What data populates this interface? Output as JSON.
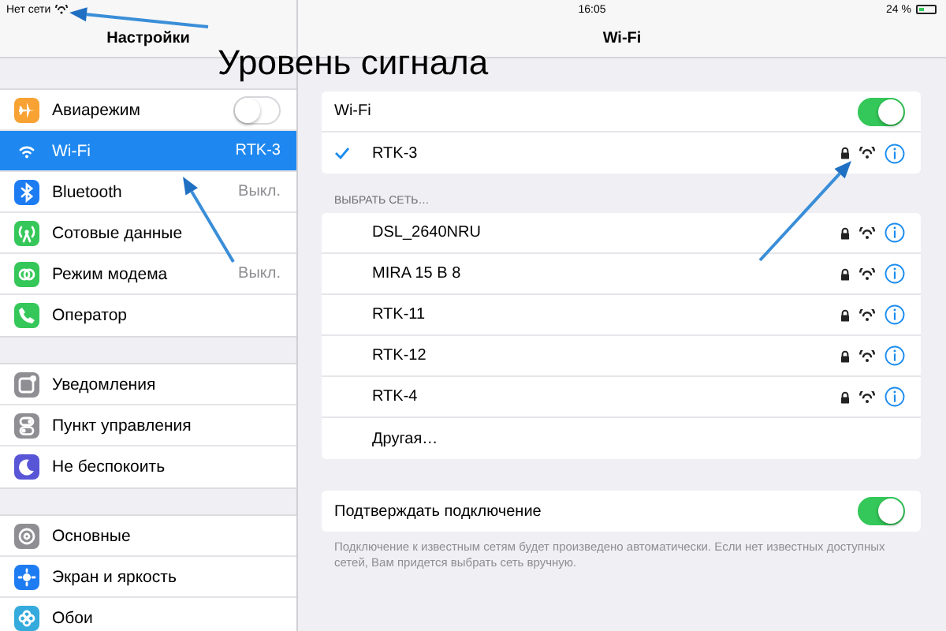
{
  "status_bar": {
    "carrier": "Нет сети",
    "time": "16:05",
    "battery": "24 %"
  },
  "annotation": {
    "text": "Уровень сигнала"
  },
  "sidebar": {
    "title": "Настройки",
    "groups": [
      [
        {
          "kind": "toggle",
          "label": "Авиарежим",
          "on": false,
          "selected": false,
          "color": "#f7a233"
        },
        {
          "kind": "link",
          "label": "Wi-Fi",
          "value": "RTK-3",
          "selected": true,
          "color": "#1e88f0"
        },
        {
          "kind": "link",
          "label": "Bluetooth",
          "value": "Выкл.",
          "selected": false,
          "color": "#1e7cf2"
        },
        {
          "kind": "link",
          "label": "Сотовые данные",
          "selected": false,
          "color": "#35c759"
        },
        {
          "kind": "link",
          "label": "Режим модема",
          "value": "Выкл.",
          "selected": false,
          "color": "#35c759"
        },
        {
          "kind": "link",
          "label": "Оператор",
          "selected": false,
          "color": "#35c759"
        }
      ],
      [
        {
          "kind": "link",
          "label": "Уведомления",
          "selected": false,
          "color": "#8e8e93"
        },
        {
          "kind": "link",
          "label": "Пункт управления",
          "selected": false,
          "color": "#8e8e93"
        },
        {
          "kind": "link",
          "label": "Не беспокоить",
          "selected": false,
          "color": "#5856d6"
        }
      ],
      [
        {
          "kind": "link",
          "label": "Основные",
          "selected": false,
          "color": "#8e8e93"
        },
        {
          "kind": "link",
          "label": "Экран и яркость",
          "selected": false,
          "color": "#1e7cf2"
        },
        {
          "kind": "link",
          "label": "Обои",
          "selected": false,
          "color": "#35aadc"
        }
      ]
    ]
  },
  "detail": {
    "title": "Wi-Fi",
    "wifi_switch": {
      "label": "Wi-Fi",
      "on": true
    },
    "current": {
      "name": "RTK-3",
      "checked": true,
      "locked": true
    },
    "section_label": "ВЫБРАТЬ СЕТЬ…",
    "networks": [
      {
        "name": "DSL_2640NRU",
        "locked": true
      },
      {
        "name": "MIRA 15 B 8",
        "locked": true
      },
      {
        "name": "RTK-11",
        "locked": true
      },
      {
        "name": "RTK-12",
        "locked": true
      },
      {
        "name": "RTK-4",
        "locked": true
      }
    ],
    "other": "Другая…",
    "ask": {
      "label": "Подтверждать подключение",
      "on": true
    },
    "footnote": "Подключение к известным сетям будет произведено автоматически. Если нет известных доступных сетей, Вам придется выбрать сеть вручную."
  }
}
